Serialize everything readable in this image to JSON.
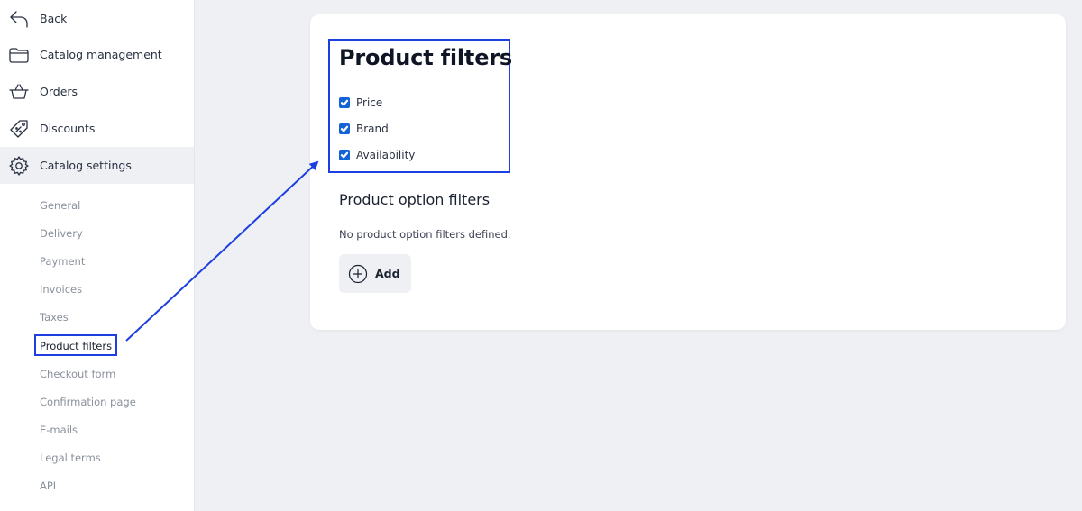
{
  "sidebar": {
    "main_items": [
      {
        "label": "Back",
        "icon": "back-arrow-icon"
      },
      {
        "label": "Catalog management",
        "icon": "folder-icon"
      },
      {
        "label": "Orders",
        "icon": "basket-icon"
      },
      {
        "label": "Discounts",
        "icon": "tag-icon"
      },
      {
        "label": "Catalog settings",
        "icon": "gear-icon"
      }
    ],
    "sub_items": [
      {
        "label": "General"
      },
      {
        "label": "Delivery"
      },
      {
        "label": "Payment"
      },
      {
        "label": "Invoices"
      },
      {
        "label": "Taxes"
      },
      {
        "label": "Product filters"
      },
      {
        "label": "Checkout form"
      },
      {
        "label": "Confirmation page"
      },
      {
        "label": "E-mails"
      },
      {
        "label": "Legal terms"
      },
      {
        "label": "API"
      }
    ],
    "active_main": "Catalog settings",
    "active_sub": "Product filters"
  },
  "main": {
    "title": "Product filters",
    "filters": [
      {
        "label": "Price",
        "checked": true
      },
      {
        "label": "Brand",
        "checked": true
      },
      {
        "label": "Availability",
        "checked": true
      }
    ],
    "option_filters_title": "Product option filters",
    "empty_message": "No product option filters defined.",
    "add_label": "Add",
    "add_icon": "plus-circle-icon"
  },
  "colors": {
    "highlight": "#1d3ee0",
    "checkbox": "#1463d6",
    "background": "#eef0f3"
  }
}
